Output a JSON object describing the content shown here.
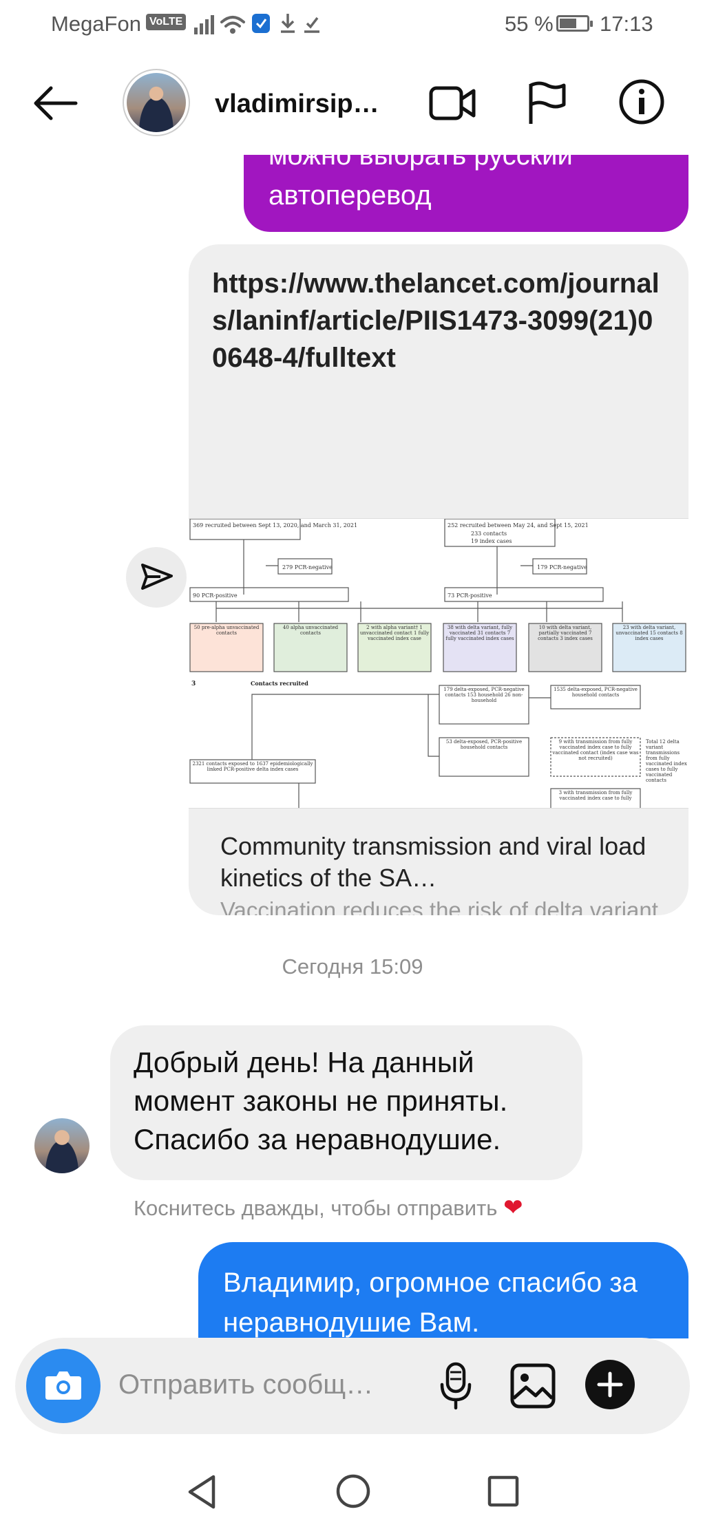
{
  "status_bar": {
    "carrier": "MegaFon",
    "volte": "VoLTE",
    "battery": "55 %",
    "time": "17:13"
  },
  "header": {
    "username": "vladimirsip…"
  },
  "messages": {
    "outgoing_1": "можно выбрать русский автоперевод",
    "link_url": "https://www.thelancet.com/journals/laninf/article/PIIS1473-3099(21)00648-4/fulltext",
    "link_title": "Community transmission and viral load kinetics of the SA…",
    "link_desc": "Vaccination reduces the risk of delta variant infection and accelerates viral clearance. Nonetheless, fully vac…",
    "timestamp": "Сегодня 15:09",
    "incoming_1": "Добрый день! На данный момент законы не приняты. Спасибо за неравнодушие.",
    "double_tap_hint": "Коснитесь дважды, чтобы отправить",
    "outgoing_2": "Владимир, огромное спасибо за неравнодушие Вам."
  },
  "preview_figure": {
    "a_recruited": "369 recruited between Sept 13, 2020, and March 31, 2021",
    "b_recruited": "252 recruited between May 24, and Sept 15, 2021",
    "b_contacts": "233 contacts",
    "b_index": "19 index cases",
    "a_pcr_neg": "279 PCR-negative",
    "b_pcr_neg": "179 PCR-negative",
    "a_pcr_pos": "90 PCR-positive",
    "b_pcr_pos": "73 PCR-positive",
    "box1": "50 pre-alpha unvaccinated contacts",
    "box2": "40 alpha unvaccinated contacts",
    "box3": "2 with alpha variant† 1 unvaccinated contact 1 fully vaccinated index case",
    "box4": "38 with delta variant, fully vaccinated 31 contacts 7 fully vaccinated index cases",
    "box5": "10 with delta variant, partially vaccinated 7 contacts 3 index cases",
    "box6": "23 with delta variant, unvaccinated 15 contacts 8 index cases",
    "c_label": "Contacts recruited",
    "c_box1": "179 delta-exposed, PCR-negative contacts 153 household 26 non-household",
    "c_box2": "1535 delta-exposed, PCR-negative household contacts",
    "c_box3": "53 delta-exposed, PCR-positive household contacts",
    "c_box4": "9 with transmission from fully vaccinated index case to fully vaccinated contact (index case was not recruited)",
    "c_side": "Total 12 delta variant transmissions from fully vaccinated index cases to fully vaccinated contacts",
    "c_box5": "2321 contacts exposed to 1637 epidemiologically linked PCR-positive delta index cases",
    "c_box6": "3 with transmission from fully vaccinated index case to fully"
  },
  "composer": {
    "placeholder": "Отправить сообщ…"
  },
  "colors": {
    "outgoing_purple": "#a116c0",
    "outgoing_blue": "#1d7cf2",
    "incoming_gray": "#efefef",
    "camera_blue": "#2b8bf0",
    "heart": "#e0172f"
  }
}
